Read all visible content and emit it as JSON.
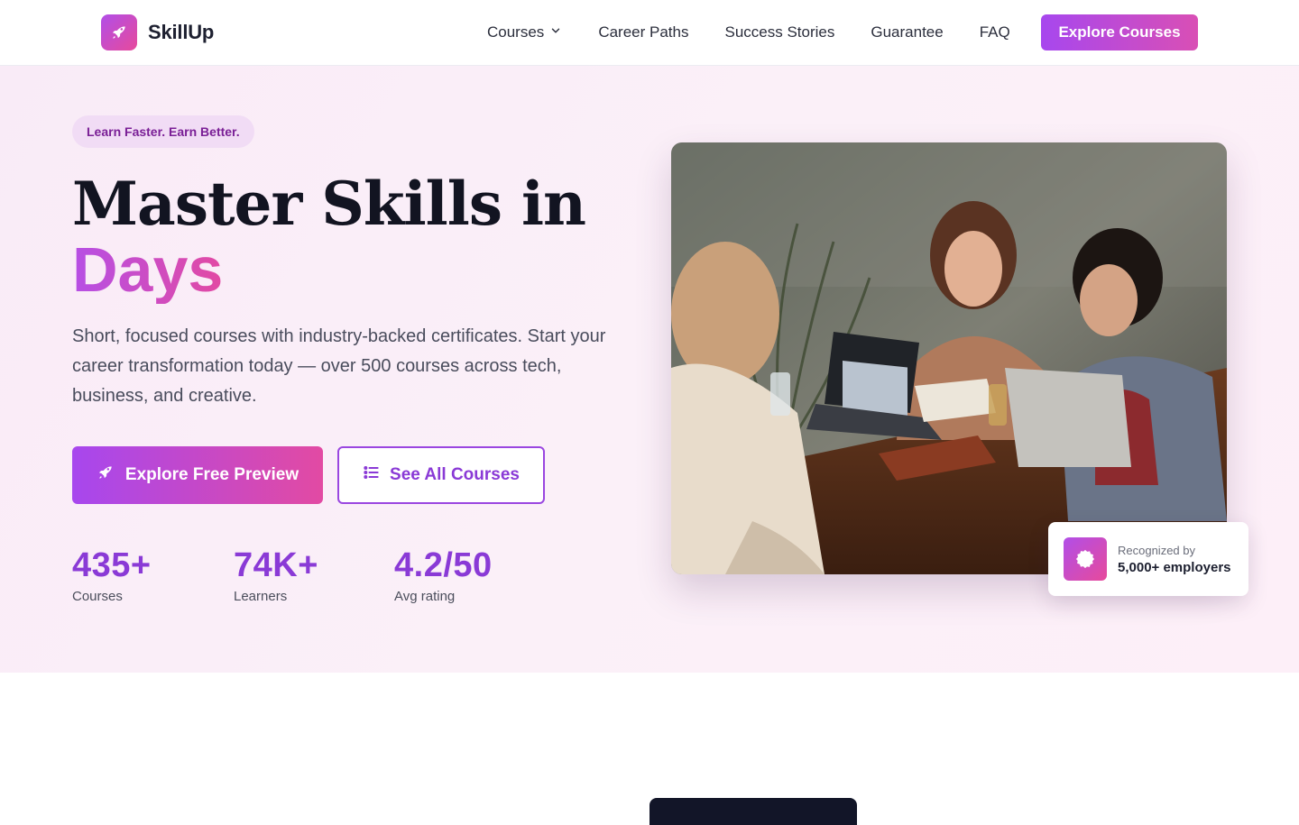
{
  "brand": {
    "name": "SkillUp",
    "logo_icon": "rocket-icon"
  },
  "nav": {
    "items": [
      {
        "label": "Courses",
        "has_dropdown": true
      },
      {
        "label": "Career Paths"
      },
      {
        "label": "Success Stories"
      },
      {
        "label": "Guarantee"
      },
      {
        "label": "FAQ"
      }
    ],
    "cta_label": "Explore Courses"
  },
  "hero": {
    "badge": "Learn Faster. Earn Better.",
    "headline": "Master Skills in",
    "headline_accent": "Days",
    "lede": "Short, focused courses with industry-backed certificates. Start your career transformation today — over 500 courses across tech, business, and creative.",
    "primary_button": {
      "label": "Explore Free Preview",
      "icon": "rocket-icon"
    },
    "secondary_button": {
      "label": "See All Courses",
      "icon": "list-icon"
    },
    "stats": [
      {
        "value": "435+",
        "label": "Courses"
      },
      {
        "value": "74K+",
        "label": "Learners"
      },
      {
        "value": "4.2/50",
        "label": "Avg rating"
      }
    ],
    "image": {
      "alt": "Three people laughing around a table with laptops"
    },
    "recognition": {
      "small": "Recognized by",
      "main": "5,000+ employers",
      "icon": "award-badge-icon"
    }
  },
  "colors": {
    "accent_start": "#a747ee",
    "accent_end": "#e24aa3",
    "accent_text": "#8a3ad6",
    "hero_bg": "#fbeef8",
    "heading": "#121421"
  }
}
